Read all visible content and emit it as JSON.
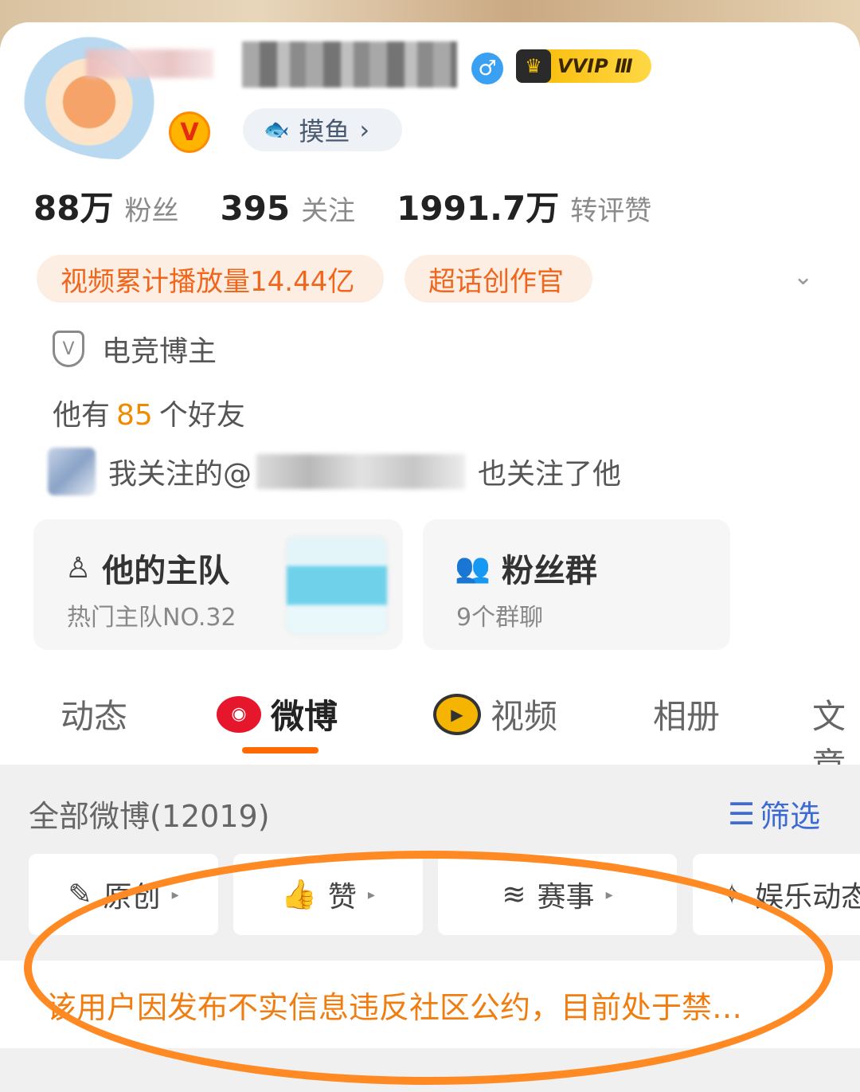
{
  "profile": {
    "vip_badge": "VVIP Ⅲ",
    "verified_badge": "V",
    "gender_symbol": "♂",
    "chip_label": "摸鱼",
    "chip_chevron": "›"
  },
  "stats": [
    {
      "value": "88万",
      "label": "粉丝"
    },
    {
      "value": "395",
      "label": "关注"
    },
    {
      "value": "1991.7万",
      "label": "转评赞"
    }
  ],
  "tags": [
    "视频累计播放量14.44亿",
    "超话创作官"
  ],
  "info": {
    "category": "电竞博主",
    "friends_prefix": "他有",
    "friends_count": "85",
    "friends_suffix": "个好友",
    "mutual_prefix": "我关注的@",
    "mutual_suffix": "也关注了他"
  },
  "cards": {
    "team": {
      "title": "他的主队",
      "subtitle": "热门主队NO.32"
    },
    "fans": {
      "title": "粉丝群",
      "subtitle": "9个群聊"
    }
  },
  "tabs": [
    {
      "label": "动态"
    },
    {
      "label": "微博"
    },
    {
      "label": "视频"
    },
    {
      "label": "相册"
    },
    {
      "label": "文章"
    }
  ],
  "posts": {
    "header": "全部微博(12019)",
    "filter_label": "筛选",
    "chips": [
      "原创",
      "赞",
      "赛事",
      "娱乐动态"
    ]
  },
  "notice": "该用户因发布不实信息违反社区公约，目前处于禁…",
  "colors": {
    "accent": "#ff6a00",
    "tag_text": "#f0661c",
    "notice_text": "#f07d10",
    "filter_blue": "#3d6bd6",
    "annotation": "#ff8a24"
  }
}
